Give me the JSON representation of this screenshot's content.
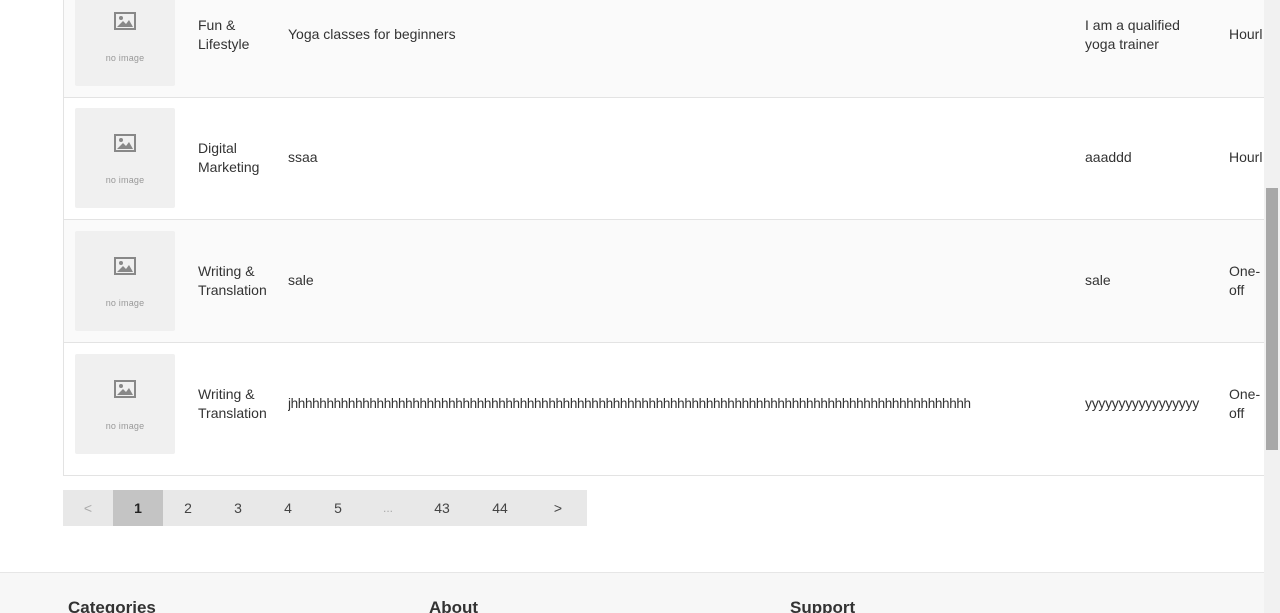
{
  "listing": {
    "thumb_text": "no image",
    "rows": [
      {
        "category": "Fun & Lifestyle",
        "title": "Yoga classes for beginners",
        "description": "I am a qualified yoga trainer",
        "type": "Hourl"
      },
      {
        "category": "Digital Marketing",
        "title": "ssaa",
        "description": "aaaddd",
        "type": "Hourl"
      },
      {
        "category": "Writing & Translation",
        "title": "sale",
        "description": "sale",
        "type": "One-off"
      },
      {
        "category": "Writing & Translation",
        "title": "jhhhhhhhhhhhhhhhhhhhhhhhhhhhhhhhhhhhhhhhhhhhhhhhhhhhhhhhhhhhhhhhhhhhhhhhhhhhhhhhhhhhhhhhhhhhhhhh",
        "description": "yyyyyyyyyyyyyyyyy",
        "type": "One-off"
      }
    ]
  },
  "pagination": {
    "prev": "<",
    "pages": [
      "1",
      "2",
      "3",
      "4",
      "5"
    ],
    "ellipsis": "...",
    "last_pages": [
      "43",
      "44"
    ],
    "next": ">",
    "current": "1"
  },
  "footer": {
    "categories": "Categories",
    "about": "About",
    "support": "Support"
  }
}
